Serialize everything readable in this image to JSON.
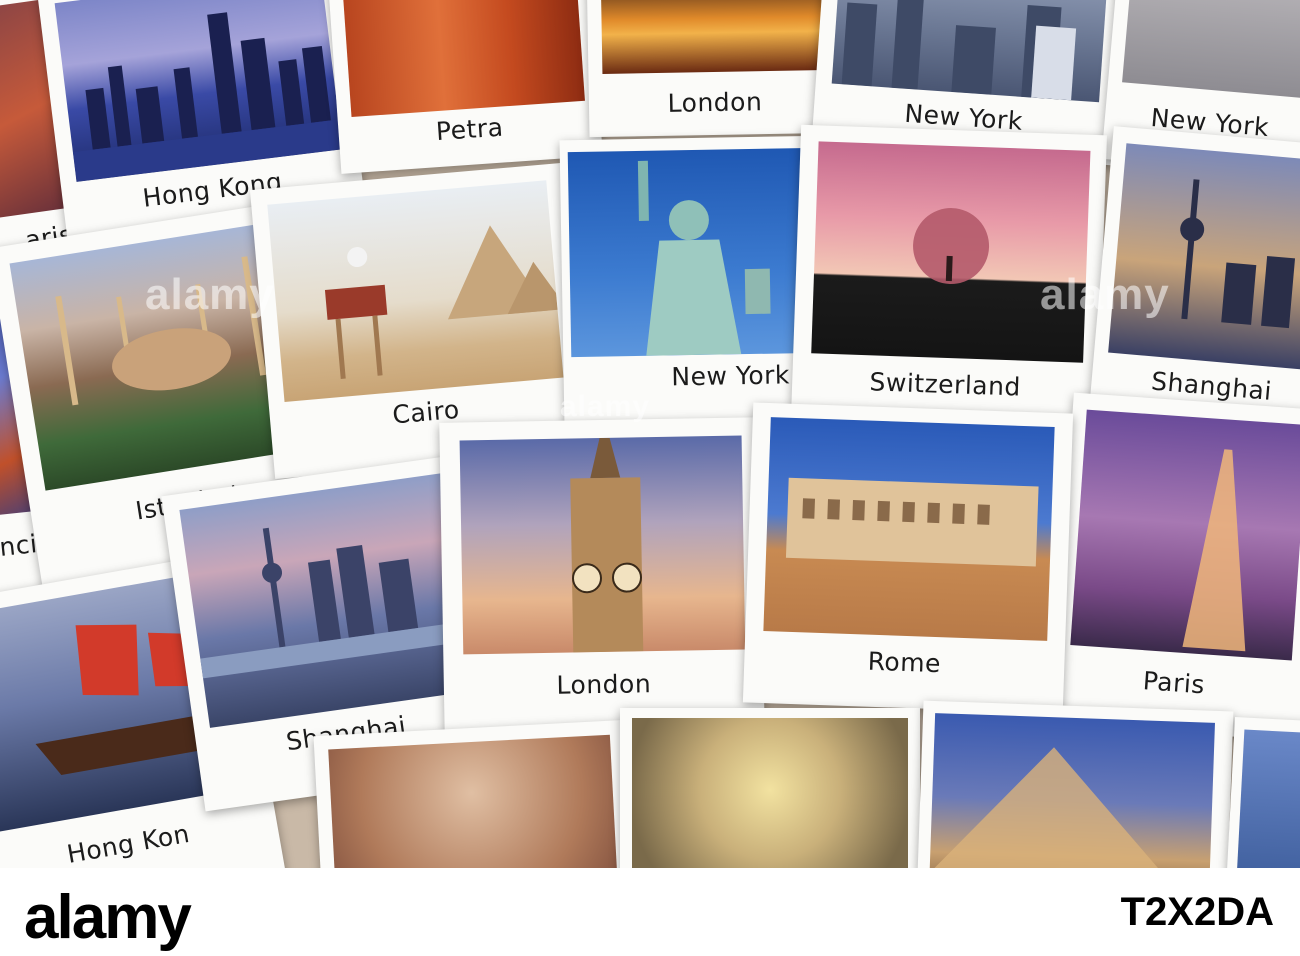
{
  "cards": [
    {
      "name": "hong-kong-top",
      "caption": "Hong Kong"
    },
    {
      "name": "petra",
      "caption": "Petra"
    },
    {
      "name": "london-top",
      "caption": "London"
    },
    {
      "name": "new-york-top",
      "caption": "New York"
    },
    {
      "name": "new-york-right",
      "caption": "New York"
    },
    {
      "name": "paris-left",
      "caption": "aris"
    },
    {
      "name": "cairo",
      "caption": "Cairo"
    },
    {
      "name": "new-york-liberty",
      "caption": "New York"
    },
    {
      "name": "switzerland",
      "caption": "Switzerland"
    },
    {
      "name": "shanghai-right",
      "caption": "Shanghai"
    },
    {
      "name": "istanbul",
      "caption": "Istanbul"
    },
    {
      "name": "san-francisco",
      "caption": "ncisco"
    },
    {
      "name": "shanghai-mid",
      "caption": "Shanghai"
    },
    {
      "name": "london-bigben",
      "caption": "London"
    },
    {
      "name": "rome",
      "caption": "Rome"
    },
    {
      "name": "paris-eiffel",
      "caption": "Paris"
    },
    {
      "name": "hong-kong-junk",
      "caption": "Hong Kon"
    }
  ],
  "watermark": "alamy",
  "footer": {
    "logo": "alamy",
    "image_id": "T2X2DA"
  }
}
